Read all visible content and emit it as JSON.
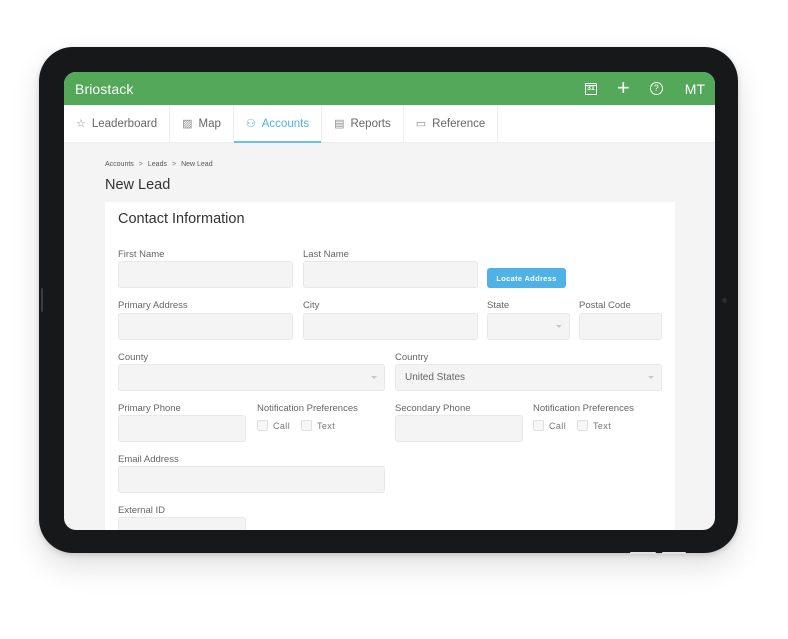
{
  "app": {
    "title": "Briostack",
    "calendar_day": "31",
    "user_initials": "MT"
  },
  "topbar_icons": [
    "calendar-icon",
    "plus-icon",
    "help-icon"
  ],
  "tabs": [
    {
      "label": "Leaderboard",
      "icon": "star-icon",
      "glyph": "☆",
      "active": false
    },
    {
      "label": "Map",
      "icon": "map-icon",
      "glyph": "▨",
      "active": false
    },
    {
      "label": "Accounts",
      "icon": "users-icon",
      "glyph": "⚇",
      "active": true
    },
    {
      "label": "Reports",
      "icon": "clipboard-icon",
      "glyph": "▤",
      "active": false
    },
    {
      "label": "Reference",
      "icon": "folder-icon",
      "glyph": "▭",
      "active": false
    }
  ],
  "breadcrumb": [
    "Accounts",
    "Leads",
    "New Lead"
  ],
  "breadcrumb_sep": ">",
  "page_title": "New Lead",
  "section_title": "Contact Information",
  "form": {
    "first_name": {
      "label": "First Name",
      "value": ""
    },
    "last_name": {
      "label": "Last Name",
      "value": ""
    },
    "locate_button": "Locate Address",
    "primary_address": {
      "label": "Primary Address",
      "value": ""
    },
    "city": {
      "label": "City",
      "value": ""
    },
    "state": {
      "label": "State",
      "value": ""
    },
    "postal_code": {
      "label": "Postal Code",
      "value": ""
    },
    "county": {
      "label": "County",
      "value": ""
    },
    "country": {
      "label": "Country",
      "value": "United States"
    },
    "primary_phone": {
      "label": "Primary Phone",
      "value": ""
    },
    "primary_notifications": {
      "label": "Notification Preferences",
      "options": [
        {
          "label": "Call",
          "checked": false
        },
        {
          "label": "Text",
          "checked": false
        }
      ]
    },
    "secondary_phone": {
      "label": "Secondary Phone",
      "value": ""
    },
    "secondary_notifications": {
      "label": "Notification Preferences",
      "options": [
        {
          "label": "Call",
          "checked": false
        },
        {
          "label": "Text",
          "checked": false
        }
      ]
    },
    "email": {
      "label": "Email Address",
      "value": ""
    },
    "external_id": {
      "label": "External ID",
      "value": ""
    }
  },
  "colors": {
    "brand_green": "#53a85a",
    "accent_blue": "#4fb2e6",
    "device_frame": "#17181a"
  }
}
